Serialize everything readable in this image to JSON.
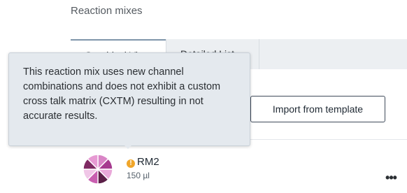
{
  "section": {
    "title": "Reaction mixes"
  },
  "tabs": [
    {
      "label": "Graphical View",
      "active": true
    },
    {
      "label": "Detailed List",
      "active": false
    }
  ],
  "toolbar": {
    "import_label": "Import from template"
  },
  "tooltip": {
    "text": "This reaction mix uses new channel combinations and does not exhibit a custom cross talk matrix (CXTM) resulting in not accurate results."
  },
  "mix": {
    "name": "RM2",
    "volume": "150 µl",
    "status_icon": "warning-icon",
    "more_label": "•••",
    "pie_colors": [
      "#d985c6",
      "#a63a8f",
      "#e9a8d9",
      "#5b1f47",
      "#c95fb0",
      "#f0c6e7",
      "#7f2a63",
      "#e79ad3"
    ]
  }
}
